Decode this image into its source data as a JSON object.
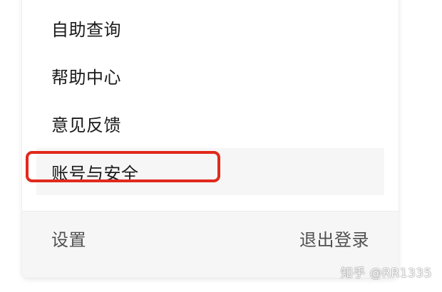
{
  "menu": {
    "items": [
      {
        "label": "自助查询"
      },
      {
        "label": "帮助中心"
      },
      {
        "label": "意见反馈"
      },
      {
        "label": "账号与安全"
      }
    ]
  },
  "footer": {
    "settings_label": "设置",
    "logout_label": "退出登录"
  },
  "watermark": {
    "text": "知乎 @RR1335"
  },
  "colors": {
    "highlight_box": "#e02a1c",
    "active_bg": "#f6f6f6",
    "footer_bg": "#f6f6f7"
  }
}
